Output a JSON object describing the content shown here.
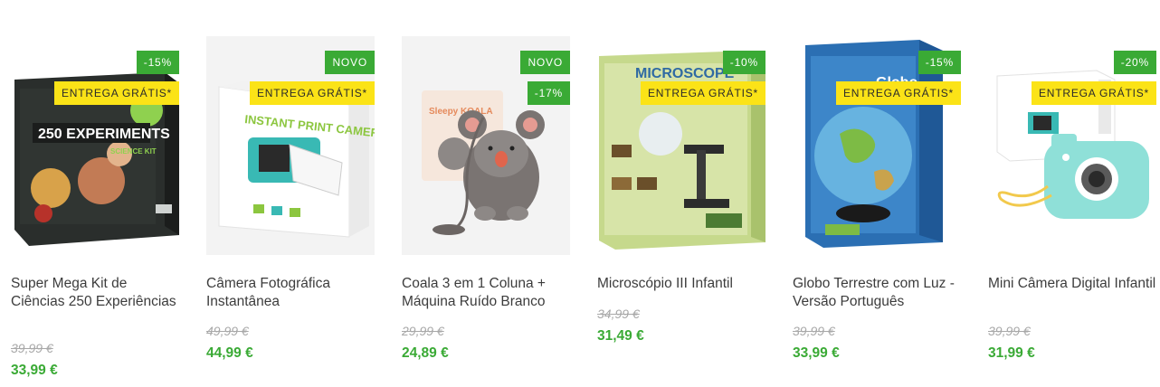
{
  "colors": {
    "accent_green": "#3aaa35",
    "badge_yellow": "#fbe317",
    "old_price": "#a8a8a8"
  },
  "products": [
    {
      "title": "Super Mega Kit de Ciências 250 Experiências",
      "badge_top": "-15%",
      "badge_ribbon": "ENTREGA GRÁTIS*",
      "box_text": "250 EXPERIMENTS",
      "box_sub": "SCIENCE KIT",
      "old_price": "39,99 €",
      "price": "33,99 €"
    },
    {
      "title": "Câmera Fotográfica Instantânea",
      "badge_top": "NOVO",
      "badge_ribbon": "ENTREGA GRÁTIS*",
      "box_text": "INSTANT PRINT CAMERA",
      "old_price": "49,99 €",
      "price": "44,99 €"
    },
    {
      "title": "Coala 3 em 1 Coluna + Máquina Ruído Branco",
      "badge_top": "NOVO",
      "badge_second": "-17%",
      "box_text": "Sleepy KOALA",
      "old_price": "29,99 €",
      "price": "24,89 €"
    },
    {
      "title": "Microscópio III Infantil",
      "badge_top": "-10%",
      "badge_ribbon": "ENTREGA GRÁTIS*",
      "box_text": "MICROSCOPE",
      "old_price": "34,99 €",
      "price": "31,49 €"
    },
    {
      "title": "Globo Terrestre com Luz - Versão Português",
      "badge_top": "-15%",
      "badge_ribbon": "ENTREGA GRÁTIS*",
      "box_text": "Globo",
      "old_price": "39,99 €",
      "price": "33,99 €"
    },
    {
      "title": "Mini Câmera Digital Infantil",
      "badge_top": "-20%",
      "badge_ribbon": "ENTREGA GRÁTIS*",
      "old_price": "39,99 €",
      "price": "31,99 €"
    }
  ]
}
